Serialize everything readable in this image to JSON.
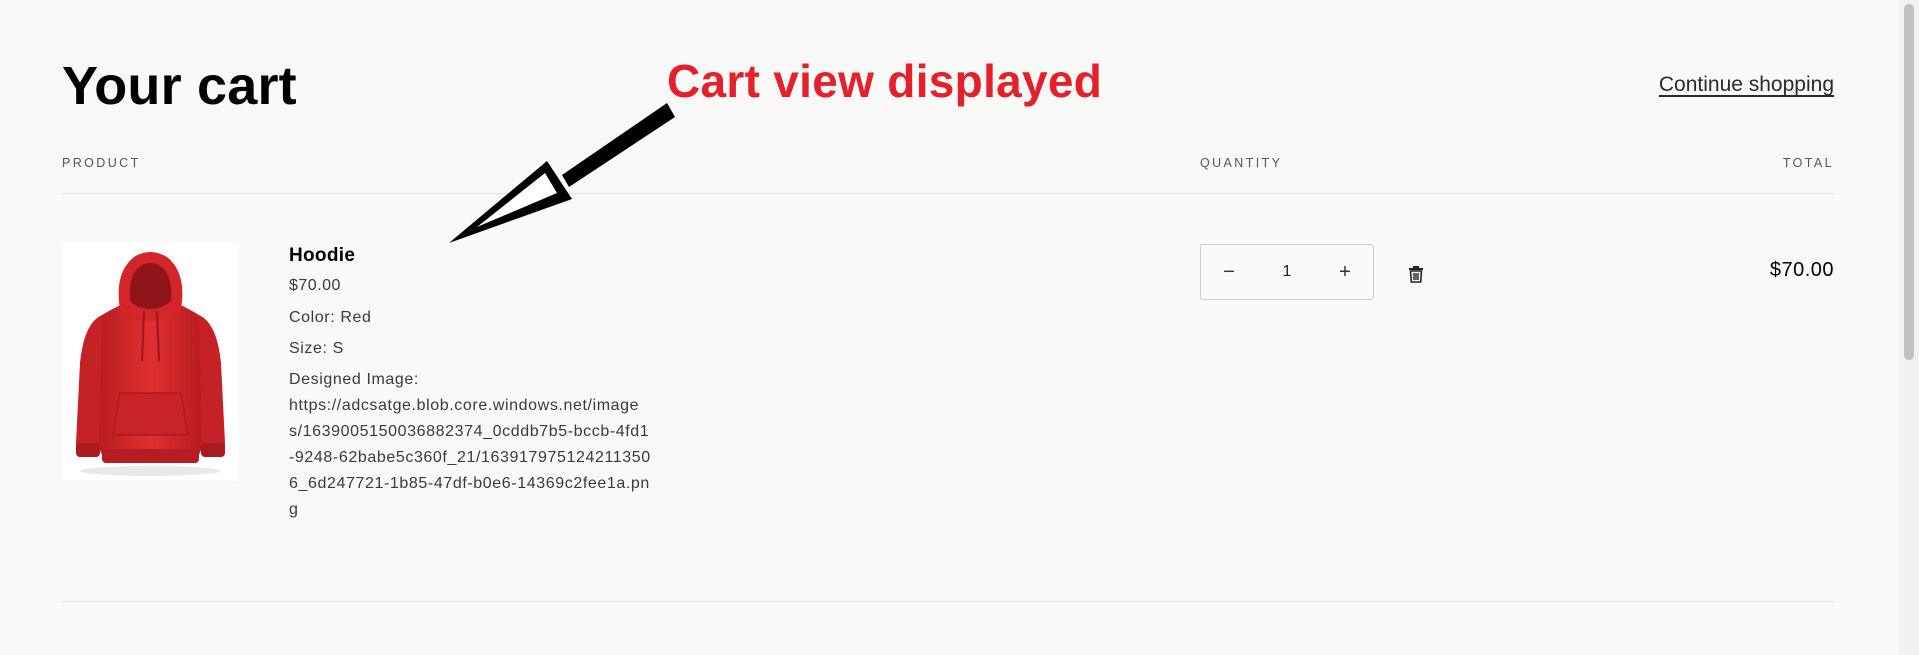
{
  "header": {
    "title": "Your cart",
    "continue_label": "Continue shopping"
  },
  "columns": {
    "product": "PRODUCT",
    "quantity": "QUANTITY",
    "total": "TOTAL"
  },
  "annotation": {
    "text": "Cart view displayed",
    "color": "#e5202b"
  },
  "cart": {
    "items": [
      {
        "name": "Hoodie",
        "price": "$70.00",
        "color_option": "Color: Red",
        "size_option": "Size: S",
        "design_label": "Designed Image:",
        "design_url": "https://adcsatge.blob.core.windows.net/images/1639005150036882374_0cddb7b5-bccb-4fd1-9248-62babe5c360f_21/1639179751242113506_6d247721-1b85-47df-b0e6-14369c2fee1a.png",
        "quantity": "1",
        "line_total": "$70.00",
        "image_icon": "red-hoodie-image",
        "decrease_symbol": "−",
        "increase_symbol": "+",
        "delete_icon": "trash-icon"
      }
    ]
  },
  "colors": {
    "background": "#f9f9f8",
    "text": "#121212",
    "hoodie": "#d9262b"
  }
}
